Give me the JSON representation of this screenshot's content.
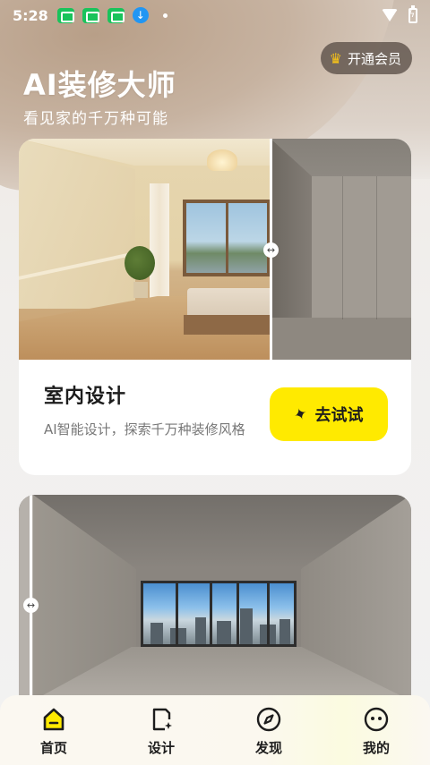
{
  "status_bar": {
    "time": "5:28",
    "download_glyph": "↓"
  },
  "header": {
    "title": "AI装修大师",
    "subtitle": "看见家的千万种可能",
    "vip_label": "开通会员"
  },
  "cards": [
    {
      "title": "室内设计",
      "description": "AI智能设计，探索千万种装修风格",
      "button_label": "去试试"
    }
  ],
  "compare_handle": "↔",
  "nav": {
    "items": [
      {
        "label": "首页",
        "icon": "home-icon",
        "active": true
      },
      {
        "label": "设计",
        "icon": "design-icon",
        "active": false
      },
      {
        "label": "发现",
        "icon": "compass-icon",
        "active": false
      },
      {
        "label": "我的",
        "icon": "profile-icon",
        "active": false
      }
    ]
  },
  "colors": {
    "accent": "#ffea00",
    "vip_crown": "#f7c318"
  }
}
